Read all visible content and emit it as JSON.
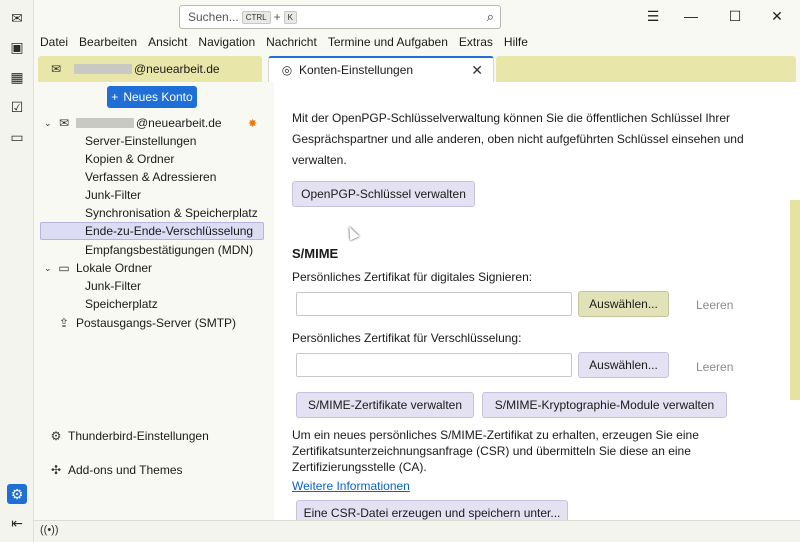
{
  "search": {
    "placeholder": "Suchen...",
    "key1": "CTRL",
    "plus": "+",
    "key2": "K"
  },
  "menubar": [
    "Datei",
    "Bearbeiten",
    "Ansicht",
    "Navigation",
    "Nachricht",
    "Termine und Aufgaben",
    "Extras",
    "Hilfe"
  ],
  "tabs": {
    "account_tab_label": "@neuearbeit.de",
    "settings_tab_label": "Konten-Einstellungen"
  },
  "tree": {
    "new_account": "Neues Konto",
    "account": "@neuearbeit.de",
    "account_items": [
      "Server-Einstellungen",
      "Kopien & Ordner",
      "Verfassen & Adressieren",
      "Junk-Filter",
      "Synchronisation & Speicherplatz",
      "Ende-zu-Ende-Verschlüsselung",
      "Empfangsbestätigungen (MDN)"
    ],
    "local_folders": "Lokale Ordner",
    "local_items": [
      "Junk-Filter",
      "Speicherplatz"
    ],
    "smtp": "Postausgangs-Server (SMTP)",
    "tb_settings": "Thunderbird-Einstellungen",
    "addons": "Add-ons und Themes"
  },
  "main": {
    "openpgp_text_1": "Mit der OpenPGP-Schlüsselverwaltung können Sie die öffentlichen Schlüssel Ihrer",
    "openpgp_text_2": "Gesprächspartner und alle anderen, oben nicht aufgeführten Schlüssel einsehen und",
    "openpgp_text_3": "verwalten.",
    "openpgp_button": "OpenPGP-Schlüssel verwalten",
    "smime_heading": "S/MIME",
    "sign_label": "Persönliches Zertifikat für digitales Signieren:",
    "sign_value": "",
    "select_button": "Auswählen...",
    "clear_button": "Leeren",
    "encrypt_label": "Persönliches Zertifikat für Verschlüsselung:",
    "encrypt_value": "",
    "manage_certs": "S/MIME-Zertifikate verwalten",
    "crypto_modules": "S/MIME-Kryptographie-Module verwalten",
    "csr_text_1": "Um ein neues persönliches S/MIME-Zertifikat zu erhalten, erzeugen Sie eine",
    "csr_text_2": "Zertifikatsunterzeichnungsanfrage (CSR) und übermitteln Sie diese an eine",
    "csr_text_3": "Zertifizierungsstelle (CA).",
    "more_info": "Weitere Informationen",
    "csr_button": "Eine CSR-Datei erzeugen und speichern unter..."
  },
  "colors": {
    "accent": "#1f6fd6",
    "tab_inactive": "#e8e6a8",
    "button": "#e4e2f2"
  }
}
